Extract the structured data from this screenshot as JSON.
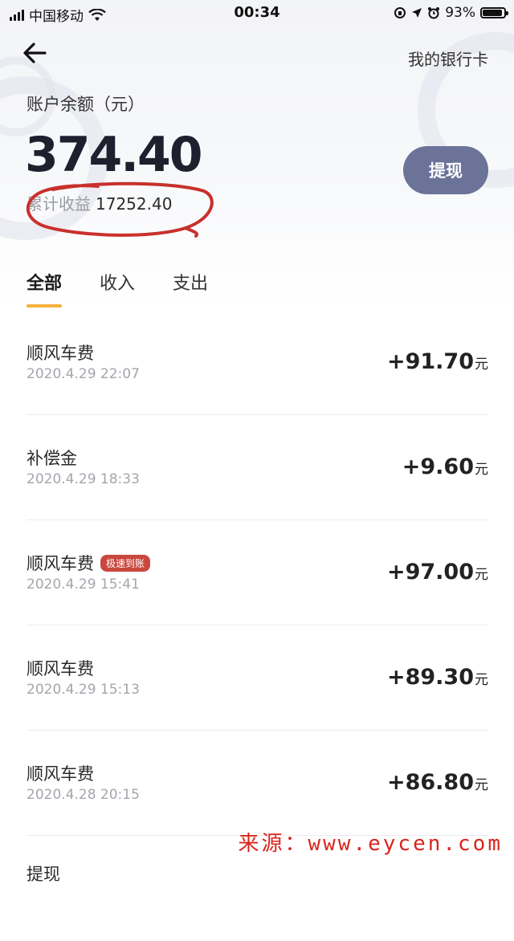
{
  "status_bar": {
    "carrier": "中国移动",
    "time": "00:34",
    "battery": "93%"
  },
  "header": {
    "back_icon": "arrow-left-icon",
    "right_link": "我的银行卡"
  },
  "account": {
    "balance_label": "账户余额（元）",
    "balance": "374.40",
    "income_label": "累计收益",
    "income_value": "17252.40",
    "withdraw_label": "提现"
  },
  "tabs": [
    {
      "label": "全部",
      "active": true
    },
    {
      "label": "收入",
      "active": false
    },
    {
      "label": "支出",
      "active": false
    }
  ],
  "transactions": [
    {
      "title": "顺风车费",
      "date": "2020.4.29 22:07",
      "amount": "+91.70",
      "unit": "元"
    },
    {
      "title": "补偿金",
      "date": "2020.4.29 18:33",
      "amount": "+9.60",
      "unit": "元"
    },
    {
      "title": "顺风车费",
      "badge": "极速到账",
      "date": "2020.4.29 15:41",
      "amount": "+97.00",
      "unit": "元"
    },
    {
      "title": "顺风车费",
      "date": "2020.4.29 15:13",
      "amount": "+89.30",
      "unit": "元"
    },
    {
      "title": "顺风车费",
      "date": "2020.4.28 20:15",
      "amount": "+86.80",
      "unit": "元"
    }
  ],
  "partial_row": {
    "title": "提现"
  },
  "watermark": "来源：www.eycen.com",
  "colors": {
    "withdraw_button": "#6b7398",
    "tab_indicator": "#f5b13a",
    "badge": "#c9473d",
    "annotation_circle": "#c9302c"
  }
}
